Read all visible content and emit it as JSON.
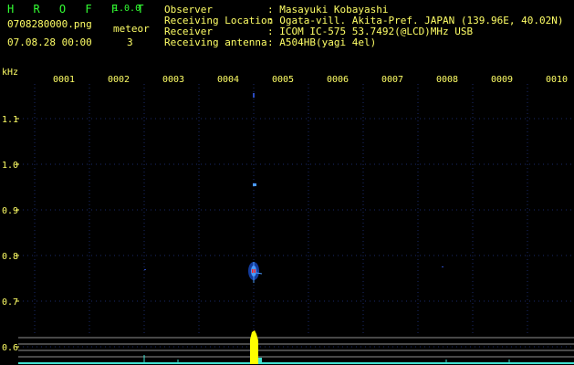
{
  "app": {
    "logo": "H R O F F T",
    "version": "1.0.0"
  },
  "file": {
    "name": "0708280000.png",
    "datetime": "07.08.28 00:00"
  },
  "meteor": {
    "label": "meteor",
    "count": "3"
  },
  "info": {
    "rows": [
      {
        "label": "Observer",
        "value": ": Masayuki Kobayashi"
      },
      {
        "label": "Receiving Location",
        "value": ": Ogata-vill. Akita-Pref. JAPAN (139.96E, 40.02N)"
      },
      {
        "label": "Receiver",
        "value": ": ICOM IC-575 53.7492(@LCD)MHz USB"
      },
      {
        "label": "Receiving antenna",
        "value": ": A504HB(yagi 4el)"
      }
    ]
  },
  "spectrogram": {
    "y_unit": "kHz",
    "y_ticks": [
      "1.1",
      "1.0",
      "0.9",
      "0.8",
      "0.7",
      "0.6"
    ],
    "y_values": [
      1.1,
      1.0,
      0.9,
      0.8,
      0.7,
      0.6
    ],
    "x_ticks": [
      "0001",
      "0002",
      "0003",
      "0004",
      "0005",
      "0006",
      "0007",
      "0008",
      "0009",
      "0010"
    ],
    "colors": {
      "label": "#ffff66",
      "grid": "#1a2a6a",
      "echo_core": "#ff2020",
      "echo_halo": "#4a9aff",
      "level_bar": "#ffff00",
      "baseline": "#40e0d0",
      "lines": "#909090"
    }
  }
}
